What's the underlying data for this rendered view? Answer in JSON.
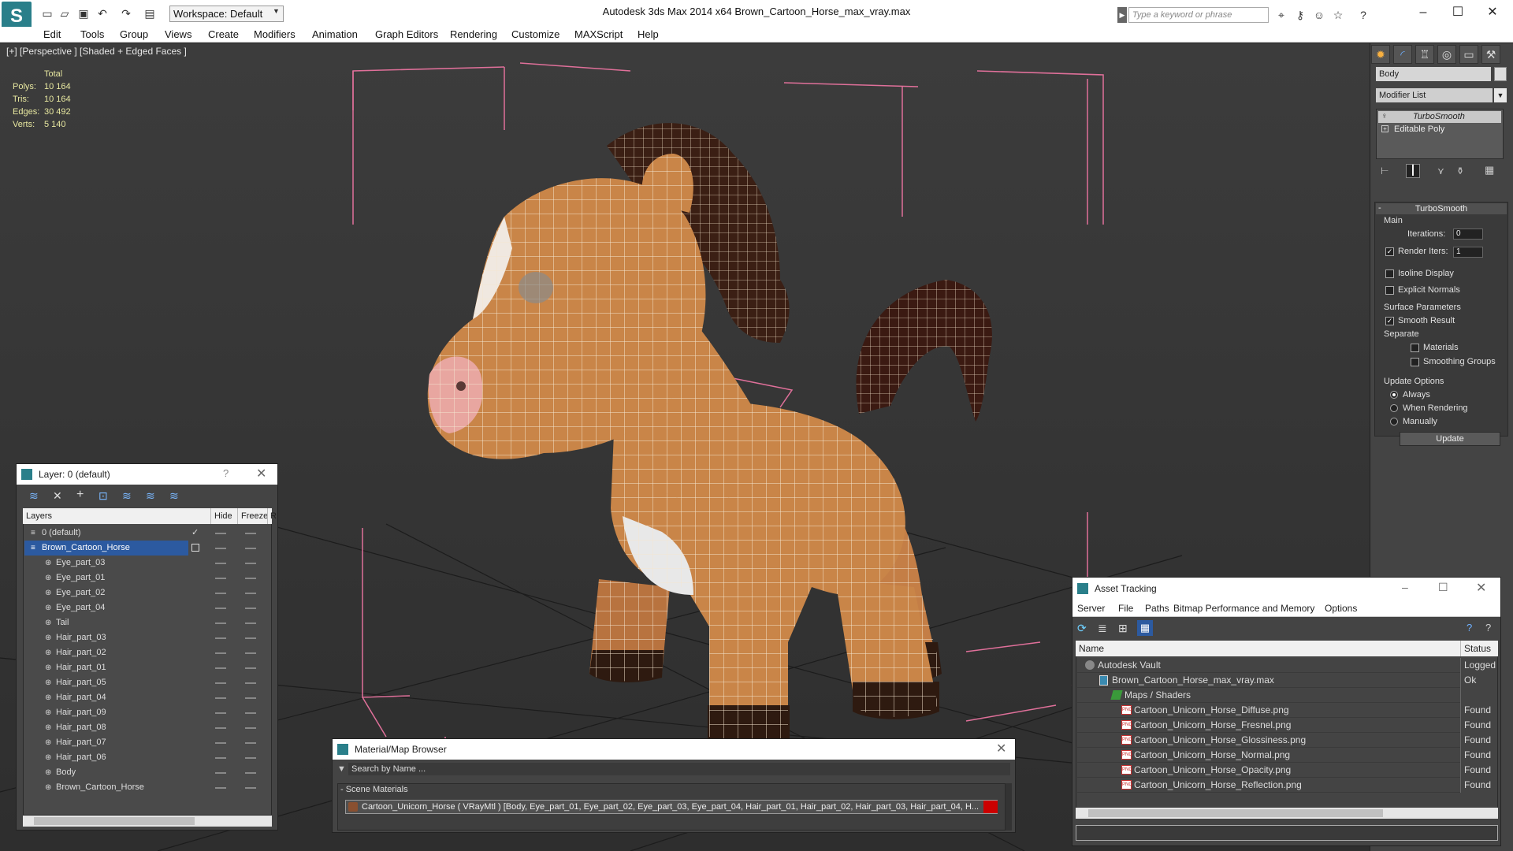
{
  "titlebar": {
    "logo": "S",
    "workspace": "Workspace: Default",
    "app_title": "Autodesk 3ds Max  2014 x64        Brown_Cartoon_Horse_max_vray.max",
    "search_placeholder": "Type a keyword or phrase"
  },
  "menu": [
    "Edit",
    "Tools",
    "Group",
    "Views",
    "Create",
    "Modifiers",
    "Animation",
    "Graph Editors",
    "Rendering",
    "Customize",
    "MAXScript",
    "Help"
  ],
  "viewport": {
    "label": "[+] [Perspective ] [Shaded + Edged Faces ]",
    "stats_header": "Total",
    "stats": [
      {
        "label": "Polys:",
        "value": "10 164"
      },
      {
        "label": "Tris:",
        "value": "10 164"
      },
      {
        "label": "Edges:",
        "value": "30 492"
      },
      {
        "label": "Verts:",
        "value": "5 140"
      }
    ]
  },
  "command_panel": {
    "object_name": "Body",
    "modifier_list": "Modifier List",
    "stack": [
      "TurboSmooth",
      "Editable Poly"
    ],
    "rollout_title": "TurboSmooth",
    "main_group": "Main",
    "iterations_label": "Iterations:",
    "iterations_value": "0",
    "render_iters_label": "Render Iters:",
    "render_iters_value": "1",
    "isoline_display": "Isoline Display",
    "explicit_normals": "Explicit Normals",
    "surface_params": "Surface Parameters",
    "smooth_result": "Smooth Result",
    "separate": "Separate",
    "materials": "Materials",
    "smoothing_groups": "Smoothing Groups",
    "update_options": "Update Options",
    "always": "Always",
    "when_rendering": "When Rendering",
    "manually": "Manually",
    "update_button": "Update"
  },
  "layer_window": {
    "title": "Layer: 0 (default)",
    "help": "?",
    "col_layers": "Layers",
    "col_hide": "Hide",
    "col_freeze": "Freeze",
    "col_r": "R",
    "rows": [
      "0 (default)",
      "Brown_Cartoon_Horse",
      "Eye_part_03",
      "Eye_part_01",
      "Eye_part_02",
      "Eye_part_04",
      "Tail",
      "Hair_part_03",
      "Hair_part_02",
      "Hair_part_01",
      "Hair_part_05",
      "Hair_part_04",
      "Hair_part_09",
      "Hair_part_08",
      "Hair_part_07",
      "Hair_part_06",
      "Body",
      "Brown_Cartoon_Horse"
    ]
  },
  "material_browser": {
    "title": "Material/Map Browser",
    "search_placeholder": "Search by Name ...",
    "section": "- Scene Materials",
    "material_line": "Cartoon_Unicorn_Horse  ( VRayMtl )  [Body, Eye_part_01, Eye_part_02, Eye_part_03, Eye_part_04, Hair_part_01, Hair_part_02, Hair_part_03, Hair_part_04, H..."
  },
  "asset_tracking": {
    "title": "Asset Tracking",
    "menu": [
      "Server",
      "File",
      "Paths",
      "Bitmap Performance and Memory",
      "Options"
    ],
    "col_name": "Name",
    "col_status": "Status",
    "rows": [
      {
        "name": "Autodesk Vault",
        "status": "Logged O"
      },
      {
        "name": "Brown_Cartoon_Horse_max_vray.max",
        "status": "Ok"
      },
      {
        "name": "Maps / Shaders",
        "status": ""
      },
      {
        "name": "Cartoon_Unicorn_Horse_Diffuse.png",
        "status": "Found"
      },
      {
        "name": "Cartoon_Unicorn_Horse_Fresnel.png",
        "status": "Found"
      },
      {
        "name": "Cartoon_Unicorn_Horse_Glossiness.png",
        "status": "Found"
      },
      {
        "name": "Cartoon_Unicorn_Horse_Normal.png",
        "status": "Found"
      },
      {
        "name": "Cartoon_Unicorn_Horse_Opacity.png",
        "status": "Found"
      },
      {
        "name": "Cartoon_Unicorn_Horse_Reflection.png",
        "status": "Found"
      }
    ]
  }
}
